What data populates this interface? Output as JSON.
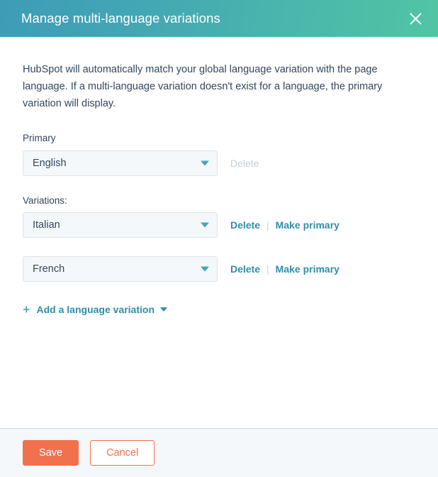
{
  "header": {
    "title": "Manage multi-language variations",
    "close_icon": "close-icon",
    "gradient_start": "#3d9cb7",
    "gradient_end": "#51c5a3"
  },
  "body": {
    "description": "HubSpot will automatically match your global language variation with the page language. If a multi-language variation doesn't exist for a language, the primary variation will display.",
    "primary": {
      "label": "Primary",
      "value": "English",
      "caret_icon": "chevron-down-icon",
      "delete_label": "Delete",
      "delete_disabled": true
    },
    "variations": {
      "label": "Variations:",
      "items": [
        {
          "value": "Italian",
          "caret_icon": "chevron-down-icon",
          "delete_label": "Delete",
          "separator": "|",
          "make_primary_label": "Make primary"
        },
        {
          "value": "French",
          "caret_icon": "chevron-down-icon",
          "delete_label": "Delete",
          "separator": "|",
          "make_primary_label": "Make primary"
        }
      ]
    },
    "add_variation": {
      "plus_icon": "+",
      "label": "Add a language variation",
      "caret_icon": "chevron-down-icon"
    },
    "link_color": "#2e8fa8",
    "disabled_color": "#c2cdd8"
  },
  "footer": {
    "save_label": "Save",
    "cancel_label": "Cancel",
    "primary_color": "#f2714d"
  }
}
